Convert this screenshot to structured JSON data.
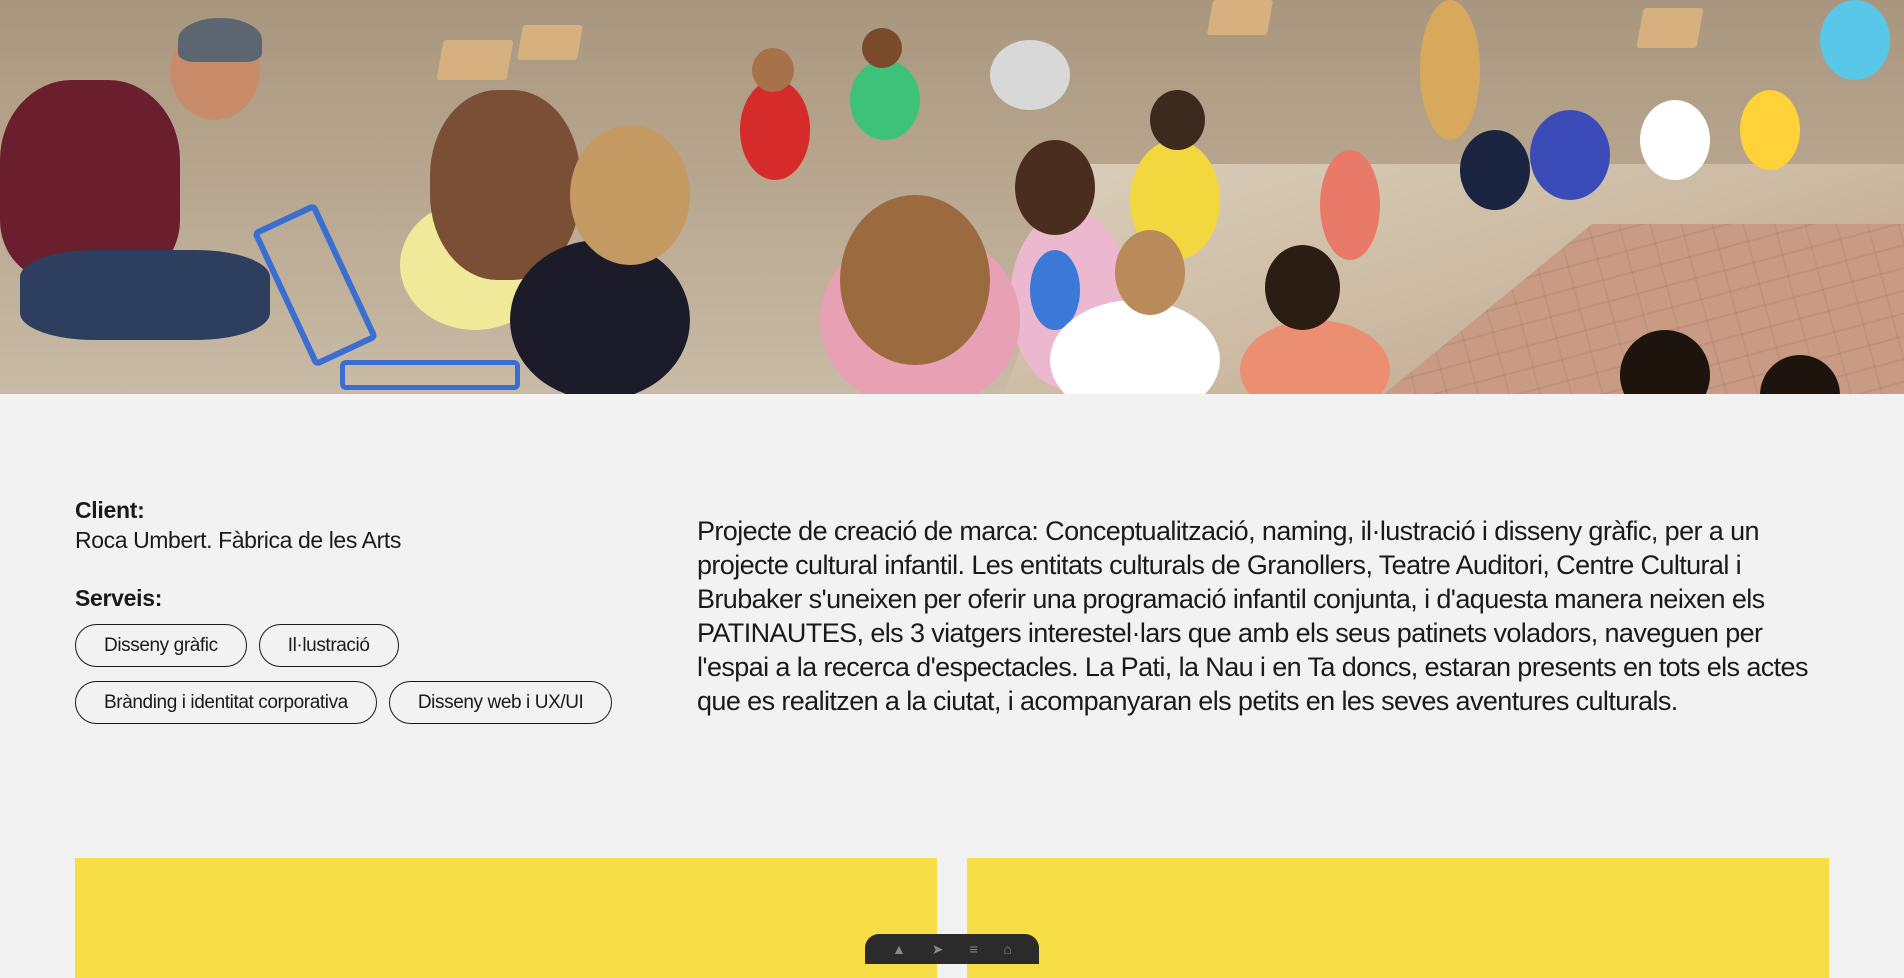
{
  "hero": {
    "image_alt": "Children and families seated outdoors watching a cultural performance"
  },
  "project": {
    "client_label": "Client:",
    "client_value": "Roca Umbert. Fàbrica de les Arts",
    "services_label": "Serveis:",
    "services": [
      "Disseny gràfic",
      "Il·lustració",
      "Brànding i identitat corporativa",
      "Disseny web i UX/UI"
    ],
    "description": "Projecte de creació de marca: Conceptualització, naming, il·lustració i disseny gràfic, per a un projecte cultural infantil. Les entitats culturals de Granollers, Teatre Auditori, Centre Cultural i Brubaker s'uneixen per oferir una programació infantil conjunta, i d'aquesta manera neixen els PATINAUTES, els 3 viatgers interestel·lars que amb els seus patinets voladors, naveguen per l'espai a la recerca d'espectacles. La Pati, la Nau i en Ta doncs, estaran presents en tots els actes que es realitzen a la ciutat, i acompanyaran els petits en les seves aventures culturals."
  },
  "gallery": {
    "card_color": "#f7dd46"
  },
  "toolbar": {
    "icons": [
      "pointer-icon",
      "arrow-icon",
      "list-icon",
      "home-icon"
    ]
  }
}
